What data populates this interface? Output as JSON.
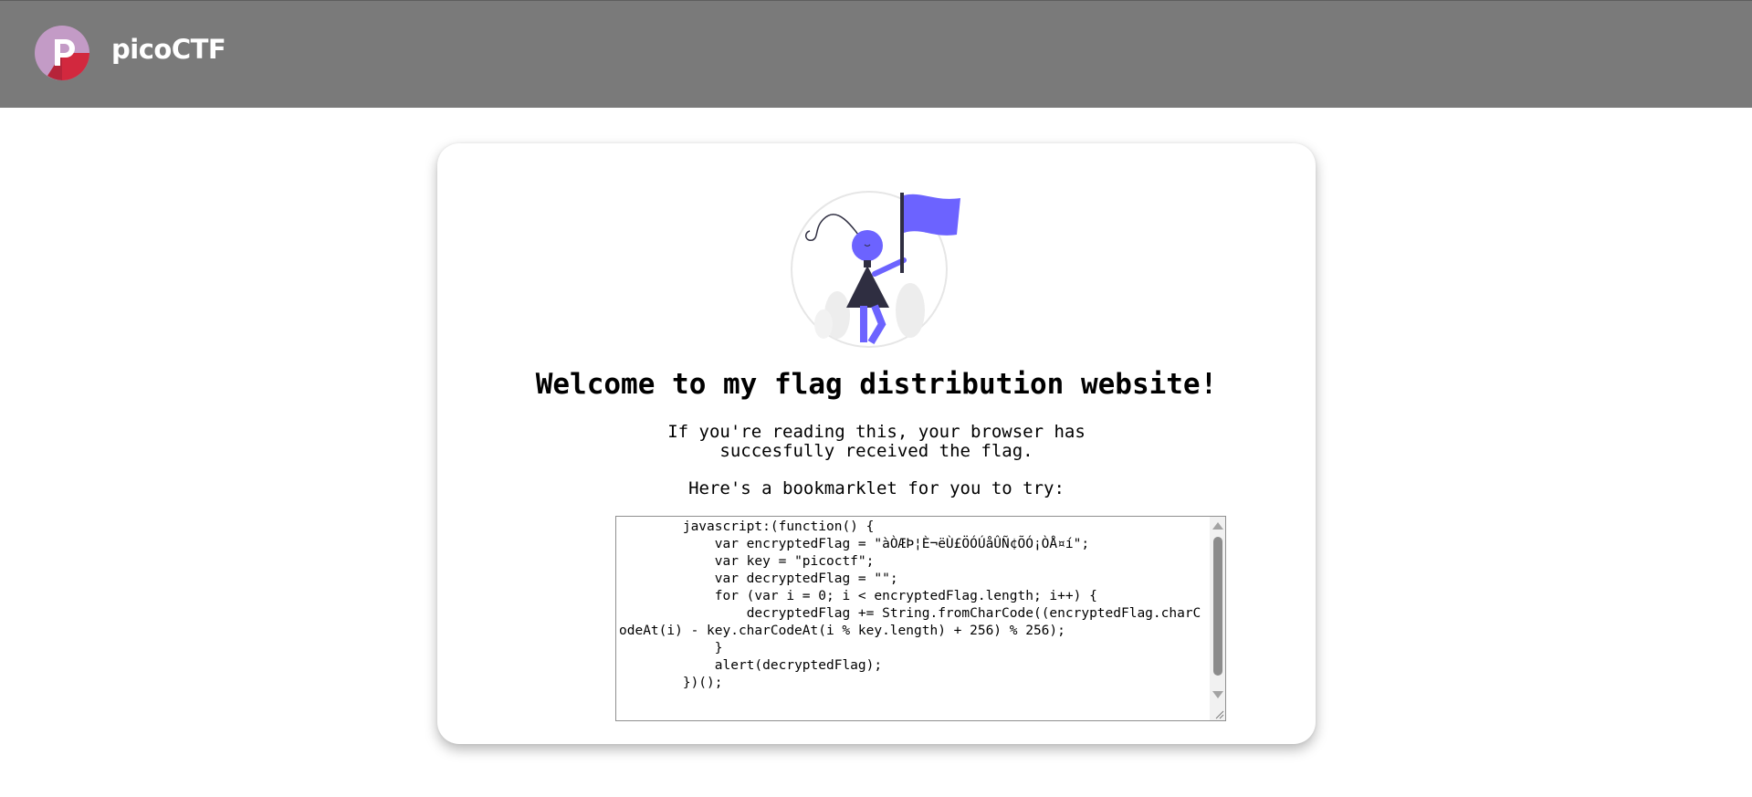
{
  "header": {
    "brand": "picoCTF",
    "bg_color": "#7a7a7a",
    "logo_icon": "picoctf-logo-icon"
  },
  "card": {
    "illustration_icon": "person-with-flag-icon",
    "accent_color": "#6c63ff",
    "title": "Welcome to my flag distribution website!",
    "subtitle_line1": "If you're reading this, your browser has",
    "subtitle_line2": "succesfully received the flag.",
    "try_line": "Here's a bookmarklet for you to try:",
    "code": "        javascript:(function() {\n            var encryptedFlag = \"àÒÆÞ¦È¬ëÙ£ÖÓÚåÛÑ¢ÕÓ¡ÒÅ¤í\";\n            var key = \"picoctf\";\n            var decryptedFlag = \"\";\n            for (var i = 0; i < encryptedFlag.length; i++) {\n                decryptedFlag += String.fromCharCode((encryptedFlag.charCodeAt(i) - key.charCodeAt(i % key.length) + 256) % 256);\n            }\n            alert(decryptedFlag);\n        })();"
  }
}
